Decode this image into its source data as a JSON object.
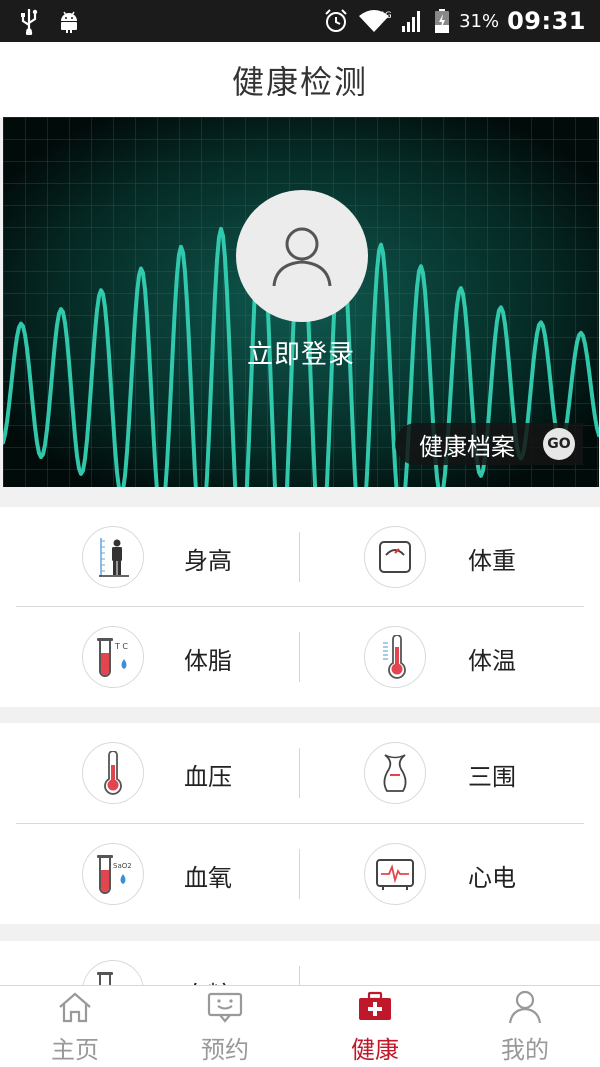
{
  "status_bar": {
    "left_icons": [
      "usb-icon",
      "android-icon"
    ],
    "right_icons": [
      "alarm-icon",
      "wifi-icon",
      "signal-icon",
      "battery-charging-icon"
    ],
    "network": "4G",
    "battery": "31%",
    "time": "09:31"
  },
  "header": {
    "title": "健康检测"
  },
  "banner": {
    "login_label": "立即登录",
    "archive_label": "健康档案",
    "go_label": "GO",
    "accent_color": "#34d1b3"
  },
  "metrics": [
    {
      "label": "身高",
      "icon": "height-icon"
    },
    {
      "label": "体重",
      "icon": "scale-icon"
    },
    {
      "label": "体脂",
      "icon": "body-fat-tube-icon",
      "tube_text": "T C"
    },
    {
      "label": "体温",
      "icon": "thermometer-icon"
    },
    {
      "label": "血压",
      "icon": "blood-pressure-thermometer-icon"
    },
    {
      "label": "三围",
      "icon": "vase-icon"
    },
    {
      "label": "血氧",
      "icon": "blood-oxygen-tube-icon",
      "tube_text": "SaO2"
    },
    {
      "label": "心电",
      "icon": "ecg-monitor-icon"
    },
    {
      "label": "血糖",
      "icon": "blood-sugar-tube-icon"
    }
  ],
  "bottom_nav": [
    {
      "label": "主页",
      "icon": "home-icon",
      "active": false
    },
    {
      "label": "预约",
      "icon": "chat-face-icon",
      "active": false
    },
    {
      "label": "健康",
      "icon": "medical-kit-icon",
      "active": true
    },
    {
      "label": "我的",
      "icon": "person-icon",
      "active": false
    }
  ],
  "colors": {
    "active": "#c0182b",
    "inactive": "#999999",
    "red_liquid": "#e2454f",
    "blue_drop": "#3b8fd8"
  }
}
